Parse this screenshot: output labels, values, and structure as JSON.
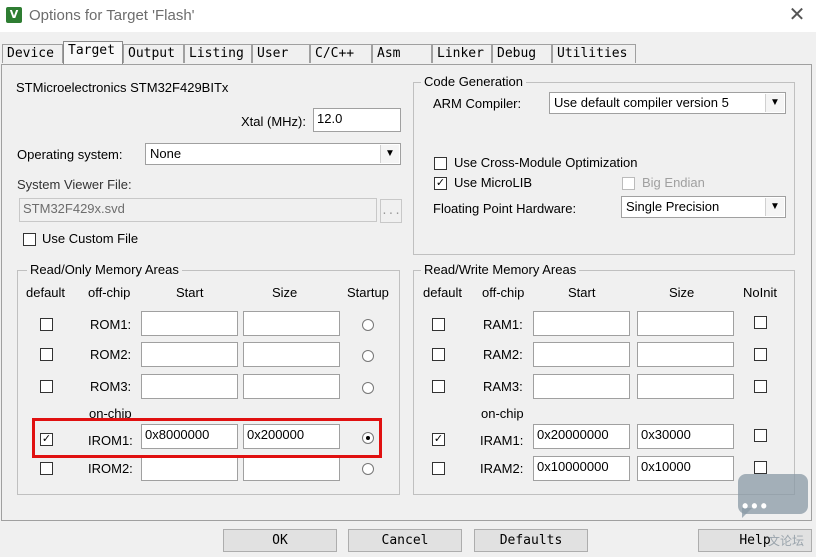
{
  "window": {
    "title": "Options for Target 'Flash'",
    "app_icon_glyph": "V",
    "close_glyph": "✕"
  },
  "tabs": [
    "Device",
    "Target",
    "Output",
    "Listing",
    "User",
    "C/C++",
    "Asm",
    "Linker",
    "Debug",
    "Utilities"
  ],
  "active_tab": "Target",
  "device": {
    "name": "STMicroelectronics STM32F429BITx",
    "xtal_label": "Xtal (MHz):",
    "xtal_value": "12.0"
  },
  "os": {
    "label": "Operating system:",
    "value": "None"
  },
  "svf": {
    "label": "System Viewer File:",
    "value": "STM32F429x.svd",
    "browse": "...",
    "custom_label": "Use Custom File"
  },
  "codegen": {
    "title": "Code Generation",
    "compiler_label": "ARM Compiler:",
    "compiler_value": "Use default compiler version 5",
    "cross_module": "Use Cross-Module Optimization",
    "microlib": "Use MicroLIB",
    "big_endian": "Big Endian",
    "fpu_label": "Floating Point Hardware:",
    "fpu_value": "Single Precision"
  },
  "rom": {
    "title": "Read/Only Memory Areas",
    "headers": {
      "default": "default",
      "offchip": "off-chip",
      "start": "Start",
      "size": "Size",
      "startup": "Startup"
    },
    "onchip_label": "on-chip",
    "rows": [
      {
        "label": "ROM1:",
        "start": "",
        "size": "",
        "default": false,
        "startup": false
      },
      {
        "label": "ROM2:",
        "start": "",
        "size": "",
        "default": false,
        "startup": false
      },
      {
        "label": "ROM3:",
        "start": "",
        "size": "",
        "default": false,
        "startup": false
      },
      {
        "label": "IROM1:",
        "start": "0x8000000",
        "size": "0x200000",
        "default": true,
        "startup": true
      },
      {
        "label": "IROM2:",
        "start": "",
        "size": "",
        "default": false,
        "startup": false
      }
    ]
  },
  "ram": {
    "title": "Read/Write Memory Areas",
    "headers": {
      "default": "default",
      "offchip": "off-chip",
      "start": "Start",
      "size": "Size",
      "noinit": "NoInit"
    },
    "onchip_label": "on-chip",
    "rows": [
      {
        "label": "RAM1:",
        "start": "",
        "size": "",
        "default": false,
        "noinit": false
      },
      {
        "label": "RAM2:",
        "start": "",
        "size": "",
        "default": false,
        "noinit": false
      },
      {
        "label": "RAM3:",
        "start": "",
        "size": "",
        "default": false,
        "noinit": false
      },
      {
        "label": "IRAM1:",
        "start": "0x20000000",
        "size": "0x30000",
        "default": true,
        "noinit": false
      },
      {
        "label": "IRAM2:",
        "start": "0x10000000",
        "size": "0x10000",
        "default": false,
        "noinit": false
      }
    ]
  },
  "buttons": {
    "ok": "OK",
    "cancel": "Cancel",
    "defaults": "Defaults",
    "help": "Help"
  },
  "watermark": {
    "dots": "•••",
    "text": "文论坛"
  },
  "colors": {
    "highlight": "#e01010"
  }
}
